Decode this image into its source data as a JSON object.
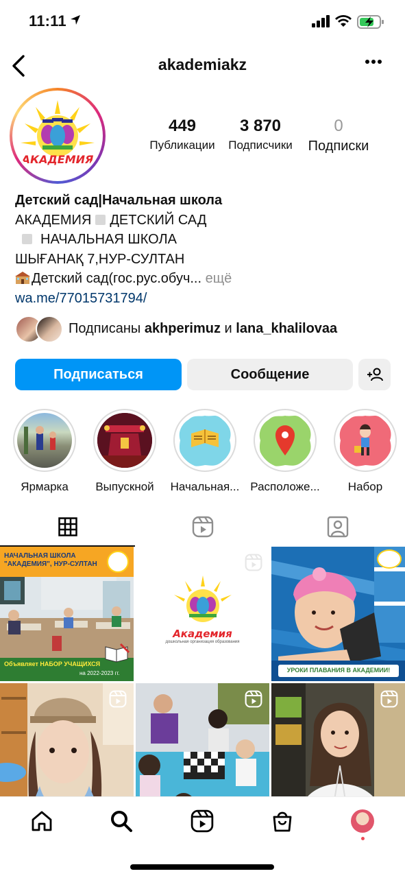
{
  "status_bar": {
    "time": "11:11"
  },
  "header": {
    "username": "akademiakz"
  },
  "profile": {
    "stats": [
      {
        "value": "449",
        "label": "Публикации"
      },
      {
        "value": "3 870",
        "label": "Подписчики"
      },
      {
        "value": "0",
        "label": "Подписки"
      }
    ],
    "bio": {
      "name": "Детский сад|Начальная школа",
      "line1_a": "АКАДЕМИЯ",
      "line1_b": "ДЕТСКИЙ САД",
      "line2": "НАЧАЛЬНАЯ ШКОЛА",
      "line3": "ШЫҒАНАҚ 7,НУР-СУЛТАН",
      "line4": "Детский сад(гос.рус.обуч...",
      "more": " ещё",
      "link": "wa.me/77015731794/"
    },
    "followed_by": {
      "prefix": "Подписаны ",
      "user1": "akhperimuz",
      "joiner": " и ",
      "user2": "lana_khalilovaa"
    }
  },
  "actions": {
    "follow": "Подписаться",
    "message": "Сообщение"
  },
  "highlights": [
    {
      "label": "Ярмарка"
    },
    {
      "label": "Выпускной"
    },
    {
      "label": "Начальная..."
    },
    {
      "label": "Расположе..."
    },
    {
      "label": "Набор"
    }
  ],
  "posts": {
    "p1_title": "НАЧАЛЬНАЯ ШКОЛА \"АКАДЕМИЯ\", НУР-СУЛТАН",
    "p1_footer_a": "Объявляет НАБОР УЧАЩИХСЯ",
    "p1_footer_b": "на 2022-2023 гг.",
    "p2_logo": "Академия",
    "p2_sub": "дошкольная организация образования",
    "p3_caption": "УРОКИ ПЛАВАНИЯ В АКАДЕМИИ!"
  },
  "colors": {
    "accent": "#0095f6",
    "link": "#00376b",
    "muted": "#8e8e8e"
  }
}
